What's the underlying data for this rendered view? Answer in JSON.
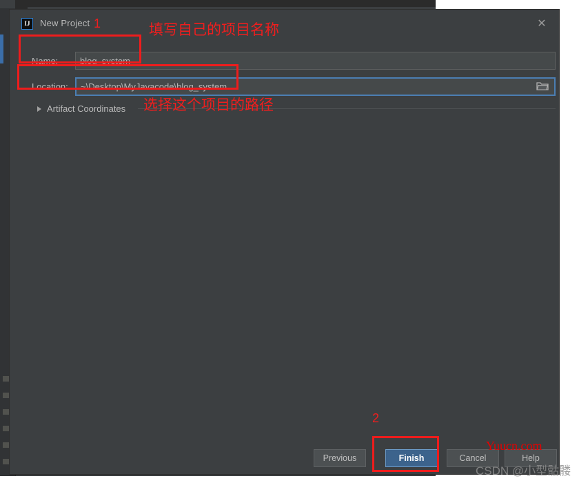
{
  "dialog": {
    "title": "New Project",
    "app_icon_text": "IJ",
    "close_icon": "close-icon",
    "accent_color": "#4b7eb3",
    "background_color": "#3c3f41"
  },
  "form": {
    "name": {
      "label": "Name:",
      "value": "blog_system",
      "placeholder": ""
    },
    "location": {
      "label": "Location:",
      "value": "~\\Desktop\\MyJavacode\\blog_system",
      "placeholder": "",
      "browse_icon": "folder-icon"
    },
    "artifact_coordinates": {
      "label": "Artifact Coordinates",
      "expanded": false,
      "arrow_icon": "chevron-right-icon"
    }
  },
  "buttons": {
    "previous": "Previous",
    "finish": "Finish",
    "cancel": "Cancel",
    "help": "Help"
  },
  "annotations": {
    "number_1": "1",
    "number_2": "2",
    "text_name": "填写自己的项目名称",
    "text_location": "选择这个项目的路径",
    "color": "#f01e1e"
  },
  "watermarks": {
    "site": "Yuucn.com",
    "author": "CSDN @小型骷髅"
  }
}
